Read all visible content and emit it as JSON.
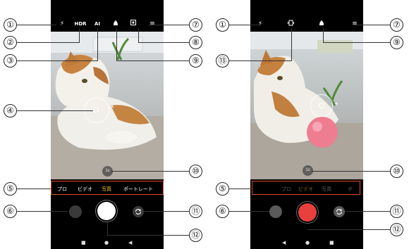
{
  "left_phone": {
    "toolbar": {
      "flash": "⚡",
      "hdr": "HDR",
      "ai": "AI",
      "settings": "≡"
    },
    "zoom_lens": "1x",
    "modes": [
      "プロ",
      "ビデオ",
      "写真",
      "ポートレート"
    ],
    "active_mode": "写真",
    "nav": {
      "stop": "■",
      "home": "●",
      "back": "◀"
    }
  },
  "right_phone": {
    "toolbar": {
      "flash": "⚡",
      "settings": "≡"
    },
    "zoom_lens": "1x",
    "modes": [
      "プロ",
      "ビデオ",
      "写真",
      "ポ"
    ],
    "nav": {
      "back": "◀",
      "home": "●",
      "stop": "■"
    }
  },
  "callouts": {
    "c1": "①",
    "c2": "②",
    "c3": "③",
    "c4": "④",
    "c5": "⑤",
    "c6": "⑥",
    "c7": "⑦",
    "c8": "⑧",
    "c9": "⑨",
    "c10": "⑩",
    "c11": "⑪",
    "c12": "⑫",
    "c13": "⑬"
  },
  "colors": {
    "mode_active": "#f4c01e",
    "shutter_video": "#e8403e",
    "bar_border": "#e04a2a"
  }
}
